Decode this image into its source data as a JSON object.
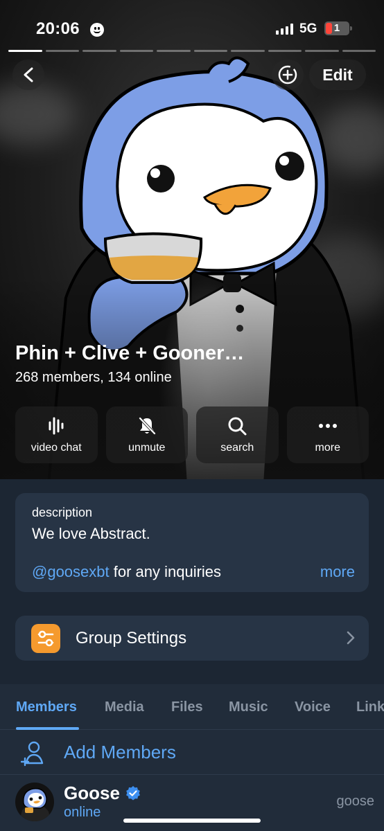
{
  "status_bar": {
    "time": "20:06",
    "network": "5G",
    "battery": "1"
  },
  "header": {
    "edit_label": "Edit"
  },
  "group": {
    "title": "Phin + Clive + Gooner…",
    "subtitle": "268 members, 134 online"
  },
  "actions": [
    {
      "label": "video chat",
      "icon": "video-chat-icon"
    },
    {
      "label": "unmute",
      "icon": "muted-bell-icon"
    },
    {
      "label": "search",
      "icon": "search-icon"
    },
    {
      "label": "more",
      "icon": "more-dots-icon"
    }
  ],
  "description": {
    "label": "description",
    "text": "We love Abstract.",
    "mention": "@goosexbt",
    "mention_suffix": " for any inquiries",
    "more_label": "more"
  },
  "settings": {
    "label": "Group Settings",
    "icon_color": "#f59a2e"
  },
  "tabs": [
    "Members",
    "Media",
    "Files",
    "Music",
    "Voice",
    "Links"
  ],
  "active_tab": "Members",
  "add_members_label": "Add Members",
  "members": [
    {
      "name": "Goose",
      "status": "online",
      "role": "goose",
      "verified": true
    }
  ],
  "colors": {
    "accent": "#5fa8f5",
    "background": "#1c2633",
    "card": "#273445"
  }
}
